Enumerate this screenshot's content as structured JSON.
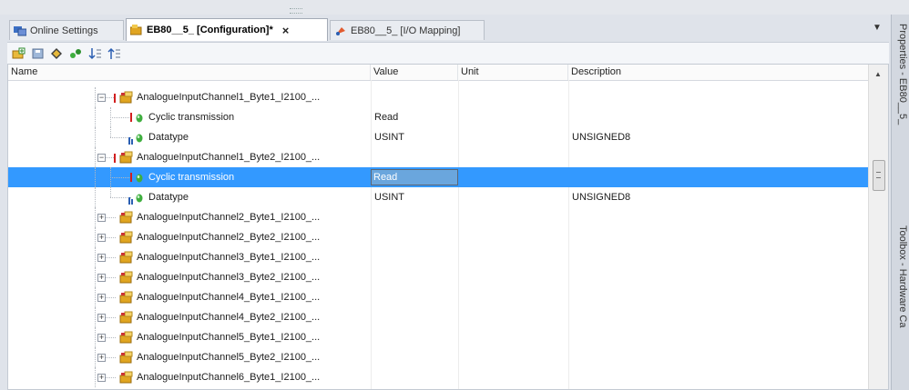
{
  "tabs": [
    {
      "label": "Online Settings",
      "active": false
    },
    {
      "label": "EB80__5_ [Configuration]*",
      "active": true
    },
    {
      "label": "EB80__5_ [I/O Mapping]",
      "active": false
    }
  ],
  "tab_close_glyph": "×",
  "tab_dropdown_glyph": "▼",
  "toolbar": {
    "icons": [
      "add-item-icon",
      "save-icon",
      "diamond-icon",
      "link-icon",
      "sort-down-icon",
      "sort-up-icon"
    ]
  },
  "table": {
    "headers": {
      "name": "Name",
      "value": "Value",
      "unit": "Unit",
      "description": "Description"
    },
    "rows": [
      {
        "name": "AnalogueInputChannel1_Byte1_I2100_...",
        "value": "",
        "unit": "",
        "description": "",
        "level": 1,
        "kind": "channel",
        "expander": "−",
        "flag": true
      },
      {
        "name": "Cyclic transmission",
        "value": "Read",
        "unit": "",
        "description": "",
        "level": 2,
        "kind": "param",
        "flag": true
      },
      {
        "name": "Datatype",
        "value": "USINT",
        "unit": "",
        "description": "UNSIGNED8",
        "level": 2,
        "kind": "param",
        "last": true
      },
      {
        "name": "AnalogueInputChannel1_Byte2_I2100_...",
        "value": "",
        "unit": "",
        "description": "",
        "level": 1,
        "kind": "channel",
        "expander": "−",
        "flag": true
      },
      {
        "name": "Cyclic transmission",
        "value": "Read",
        "unit": "",
        "description": "",
        "level": 2,
        "kind": "param",
        "flag": true,
        "selected": true
      },
      {
        "name": "Datatype",
        "value": "USINT",
        "unit": "",
        "description": "UNSIGNED8",
        "level": 2,
        "kind": "param",
        "last": true
      },
      {
        "name": "AnalogueInputChannel2_Byte1_I2100_...",
        "value": "",
        "unit": "",
        "description": "",
        "level": 1,
        "kind": "channel",
        "expander": "+"
      },
      {
        "name": "AnalogueInputChannel2_Byte2_I2100_...",
        "value": "",
        "unit": "",
        "description": "",
        "level": 1,
        "kind": "channel",
        "expander": "+"
      },
      {
        "name": "AnalogueInputChannel3_Byte1_I2100_...",
        "value": "",
        "unit": "",
        "description": "",
        "level": 1,
        "kind": "channel",
        "expander": "+"
      },
      {
        "name": "AnalogueInputChannel3_Byte2_I2100_...",
        "value": "",
        "unit": "",
        "description": "",
        "level": 1,
        "kind": "channel",
        "expander": "+"
      },
      {
        "name": "AnalogueInputChannel4_Byte1_I2100_...",
        "value": "",
        "unit": "",
        "description": "",
        "level": 1,
        "kind": "channel",
        "expander": "+"
      },
      {
        "name": "AnalogueInputChannel4_Byte2_I2100_...",
        "value": "",
        "unit": "",
        "description": "",
        "level": 1,
        "kind": "channel",
        "expander": "+"
      },
      {
        "name": "AnalogueInputChannel5_Byte1_I2100_...",
        "value": "",
        "unit": "",
        "description": "",
        "level": 1,
        "kind": "channel",
        "expander": "+"
      },
      {
        "name": "AnalogueInputChannel5_Byte2_I2100_...",
        "value": "",
        "unit": "",
        "description": "",
        "level": 1,
        "kind": "channel",
        "expander": "+"
      },
      {
        "name": "AnalogueInputChannel6_Byte1_I2100_...",
        "value": "",
        "unit": "",
        "description": "",
        "level": 1,
        "kind": "channel",
        "expander": "+"
      }
    ]
  },
  "side_panels": [
    {
      "label": "Properties - EB80__5_"
    },
    {
      "label": "Toolbox - Hardware Ca"
    }
  ],
  "colors": {
    "selection": "#3399ff",
    "channel_icon": "#e0a521",
    "param_icon": "#3fae3f",
    "flag": "#d21f1f",
    "datatype_badge": "#2b5fb3"
  }
}
